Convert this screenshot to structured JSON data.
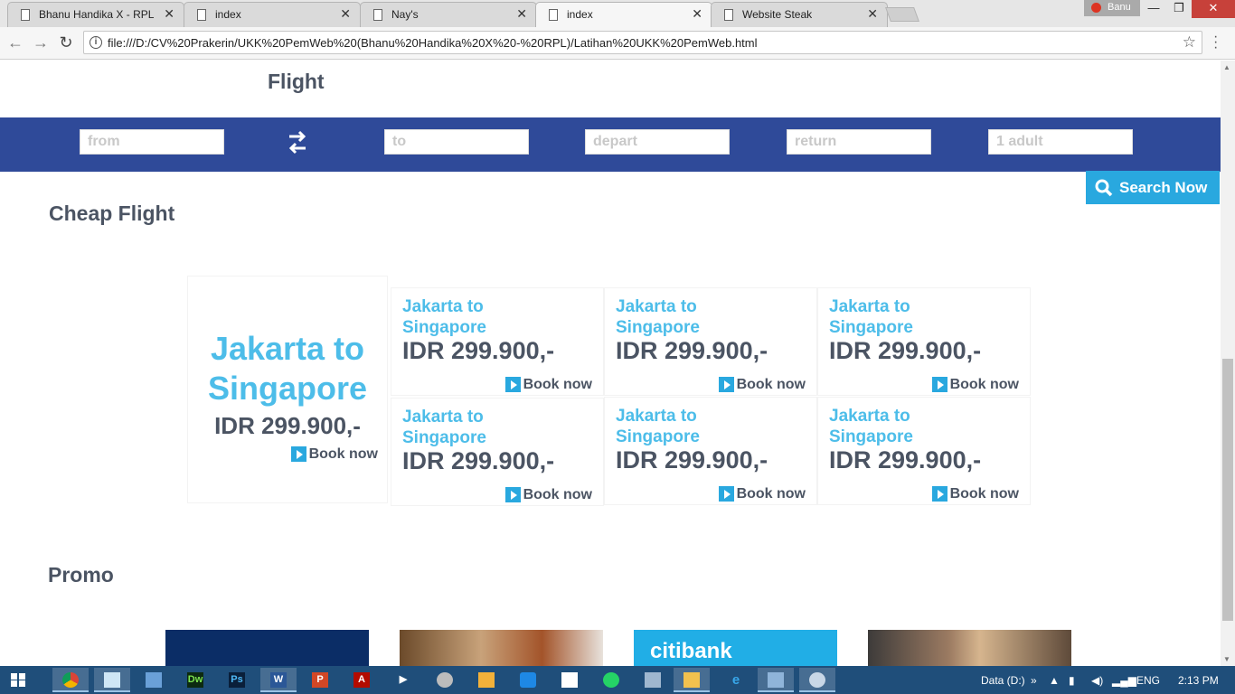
{
  "browser": {
    "tabs": [
      {
        "title": "Bhanu Handika X - RPL",
        "active": false
      },
      {
        "title": "index",
        "active": false
      },
      {
        "title": "Nay's",
        "active": false
      },
      {
        "title": "index",
        "active": true
      },
      {
        "title": "Website Steak",
        "active": false
      }
    ],
    "profile_name": "Banu",
    "url": "file:///D:/CV%20Prakerin/UKK%20PemWeb%20(Bhanu%20Handika%20X%20-%20RPL)/Latihan%20UKK%20PemWeb.html"
  },
  "page": {
    "flight_heading": "Flight",
    "search": {
      "from_placeholder": "from",
      "to_placeholder": "to",
      "depart_placeholder": "depart",
      "return_placeholder": "return",
      "passengers_placeholder": "1 adult",
      "button_label": "Search Now"
    },
    "cheap_flight_heading": "Cheap Flight",
    "featured_card": {
      "route": "Jakarta to Singapore",
      "price": "IDR 299.900,-",
      "book_label": "Book now"
    },
    "cards": [
      {
        "route": "Jakarta to Singapore",
        "price": "IDR 299.900,-",
        "book_label": "Book now"
      },
      {
        "route": "Jakarta to Singapore",
        "price": "IDR 299.900,-",
        "book_label": "Book now"
      },
      {
        "route": "Jakarta to Singapore",
        "price": "IDR 299.900,-",
        "book_label": "Book now"
      },
      {
        "route": "Jakarta to Singapore",
        "price": "IDR 299.900,-",
        "book_label": "Book now"
      },
      {
        "route": "Jakarta to Singapore",
        "price": "IDR 299.900,-",
        "book_label": "Book now"
      },
      {
        "route": "Jakarta to Singapore",
        "price": "IDR 299.900,-",
        "book_label": "Book now"
      }
    ],
    "promo_heading": "Promo",
    "promo_citibank_text": "citibank"
  },
  "taskbar": {
    "apps": [
      "start-icon",
      "chrome-icon",
      "notepad-icon",
      "virtualbox-icon",
      "dreamweaver-icon",
      "photoshop-icon",
      "word-icon",
      "powerpoint-icon",
      "acrobat-icon",
      "media-player-icon",
      "chrome-dev-icon",
      "files-icon",
      "sync-icon",
      "document-icon",
      "whatsapp-icon",
      "network-icon",
      "explorer-icon",
      "ie-icon",
      "window-icon",
      "settings-icon"
    ],
    "glyphs": {
      "dreamweaver": "Dw",
      "photoshop": "Ps",
      "word": "W",
      "powerpoint": "P",
      "acrobat": "A"
    },
    "drive_label": "Data (D:)",
    "language": "ENG",
    "time": "2:13 PM"
  },
  "colors": {
    "nav_blue": "#2f4a99",
    "accent": "#29a8df",
    "route_text": "#4dbde9",
    "heading_text": "#4b5463"
  }
}
